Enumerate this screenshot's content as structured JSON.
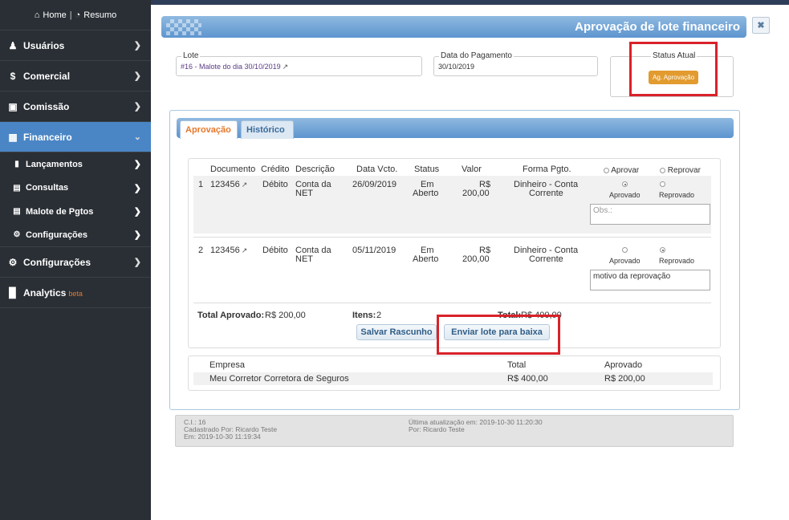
{
  "sidebar": {
    "home_label": "Home",
    "resumo_label": "Resumo",
    "items": [
      {
        "label": "Usuários",
        "icon": "users-icon"
      },
      {
        "label": "Comercial",
        "icon": "dollar-icon"
      },
      {
        "label": "Comissão",
        "icon": "money-icon"
      },
      {
        "label": "Financeiro",
        "icon": "briefcase-icon"
      },
      {
        "label": "Configurações",
        "icon": "gears-icon"
      },
      {
        "label": "Analytics",
        "icon": "bar-chart-icon",
        "badge": "beta"
      }
    ],
    "subitems": [
      {
        "label": "Lançamentos",
        "icon": "file-icon"
      },
      {
        "label": "Consultas",
        "icon": "file-text-icon"
      },
      {
        "label": "Malote de Pgtos",
        "icon": "list-icon"
      },
      {
        "label": "Configurações",
        "icon": "gear-icon"
      }
    ]
  },
  "page": {
    "title": "Aprovação de lote financeiro",
    "close": "✖"
  },
  "form": {
    "lote_legend": "Lote",
    "lote_value": "#16 - Malote do dia 30/10/2019",
    "data_legend": "Data do Pagamento",
    "data_value": "30/10/2019",
    "status_legend": "Status Atual",
    "status_value": "Ag. Aprovação"
  },
  "tabs": [
    {
      "label": "Aprovação"
    },
    {
      "label": "Histórico"
    }
  ],
  "table": {
    "headers": [
      "Documento",
      "Crédito",
      "Descrição",
      "Data Vcto.",
      "Status",
      "Valor",
      "Forma Pgto."
    ],
    "aprovar_label": "Aprovar",
    "reprovar_label": "Reprovar",
    "aprovado_label": "Aprovado",
    "reprovado_label": "Reprovado",
    "rows": [
      {
        "n": "1",
        "doc": "123456",
        "credito": "Débito",
        "desc1": "Conta da",
        "desc2": "NET",
        "data": "26/09/2019",
        "status1": "Em",
        "status2": "Aberto",
        "valor1": "R$",
        "valor2": "200,00",
        "forma1": "Dinheiro - Conta",
        "forma2": "Corrente",
        "obs": "",
        "obs_placeholder": "Obs.:"
      },
      {
        "n": "2",
        "doc": "123456",
        "credito": "Débito",
        "desc1": "Conta da",
        "desc2": "NET",
        "data": "05/11/2019",
        "status1": "Em",
        "status2": "Aberto",
        "valor1": "R$",
        "valor2": "200,00",
        "forma1": "Dinheiro - Conta",
        "forma2": "Corrente",
        "obs": "motivo da reprovação",
        "obs_placeholder": ""
      }
    ],
    "total_aprovado_label": "Total Aprovado:",
    "total_aprovado_value": "R$ 200,00",
    "itens_label": "Itens:",
    "itens_value": "2",
    "total_label": "Total:",
    "total_value": "R$ 400,00"
  },
  "buttons": {
    "salvar": "Salvar Rascunho",
    "enviar": "Enviar lote para baixa"
  },
  "summary": {
    "headers": [
      "Empresa",
      "Total",
      "Aprovado"
    ],
    "row": [
      "Meu Corretor Corretora de Seguros",
      "R$ 400,00",
      "R$ 200,00"
    ]
  },
  "footer": {
    "ci": "C.I.: 16",
    "cadastrado": "Cadastrado Por: Ricardo Teste",
    "em": "Em: 2019-10-30 11:19:34",
    "ultima": "Última atualização em: 2019-10-30 11:20:30",
    "por": "Por: Ricardo Teste"
  },
  "colors": {
    "accent": "#4a86c5",
    "sidebar_bg": "#2a2f35",
    "status_badge": "#e29b2e",
    "highlight": "#d9222a"
  }
}
